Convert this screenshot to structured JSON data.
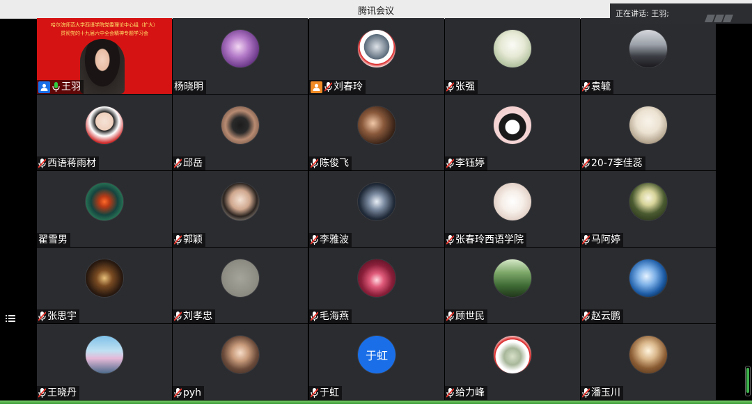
{
  "window": {
    "title": "腾讯会议"
  },
  "speaking": {
    "label": "正在讲话: 王羽;"
  },
  "video_banner": {
    "line1": "哈尔滨师范大学西语学院党委理论中心组（扩大）",
    "line2": "贯彻党的十九届六中全会精神专题学习会"
  },
  "participants": [
    {
      "name": "王羽",
      "avatar": "video",
      "badge": "blue",
      "mic": "on"
    },
    {
      "name": "杨晓明",
      "avatar": "purple-flower",
      "mic": "none"
    },
    {
      "name": "刘春玲",
      "avatar": "photo-portrait",
      "badge": "orange",
      "mic": "muted"
    },
    {
      "name": "张强",
      "avatar": "sketch",
      "mic": "muted"
    },
    {
      "name": "袁毓",
      "avatar": "street",
      "mic": "muted"
    },
    {
      "name": "西语蒋雨材",
      "avatar": "anime-boy",
      "mic": "muted"
    },
    {
      "name": "邱岳",
      "avatar": "girl-mask",
      "mic": "muted"
    },
    {
      "name": "陈俊飞",
      "avatar": "girl-dark",
      "mic": "muted"
    },
    {
      "name": "李钰婷",
      "avatar": "penguin",
      "mic": "muted"
    },
    {
      "name": "20-7李佳蕊",
      "avatar": "woman-light",
      "mic": "muted"
    },
    {
      "name": "翟雪男",
      "avatar": "dragon-eye",
      "mic": "none"
    },
    {
      "name": "郭颖",
      "avatar": "woman-pose",
      "mic": "muted"
    },
    {
      "name": "李雅波",
      "avatar": "dancer",
      "mic": "muted"
    },
    {
      "name": "张春玲西语学院",
      "avatar": "white-dress",
      "mic": "muted"
    },
    {
      "name": "马阿婷",
      "avatar": "white-flower",
      "mic": "muted"
    },
    {
      "name": "张思宇",
      "avatar": "night-room",
      "mic": "muted"
    },
    {
      "name": "刘孝忠",
      "avatar": "gray",
      "mic": "muted"
    },
    {
      "name": "毛海燕",
      "avatar": "red-bokeh",
      "mic": "muted"
    },
    {
      "name": "顾世民",
      "avatar": "forest",
      "mic": "muted"
    },
    {
      "name": "赵云鹏",
      "avatar": "earth",
      "mic": "muted"
    },
    {
      "name": "王晓丹",
      "avatar": "lake-bird",
      "mic": "muted"
    },
    {
      "name": "pyh",
      "avatar": "doll",
      "mic": "muted"
    },
    {
      "name": "于虹",
      "avatar": "text",
      "avatar_text": "于虹",
      "mic": "muted"
    },
    {
      "name": "给力峰",
      "avatar": "group-photo",
      "mic": "muted"
    },
    {
      "name": "潘玉川",
      "avatar": "warm-interior",
      "mic": "muted"
    }
  ],
  "colors": {
    "tile_bg": "#2b2c30",
    "video_bg": "#d61313",
    "text_avatar": "#1a6fe8"
  },
  "icons": [
    "menu-icon",
    "mic-icon",
    "mic-muted-icon",
    "user-icon"
  ]
}
